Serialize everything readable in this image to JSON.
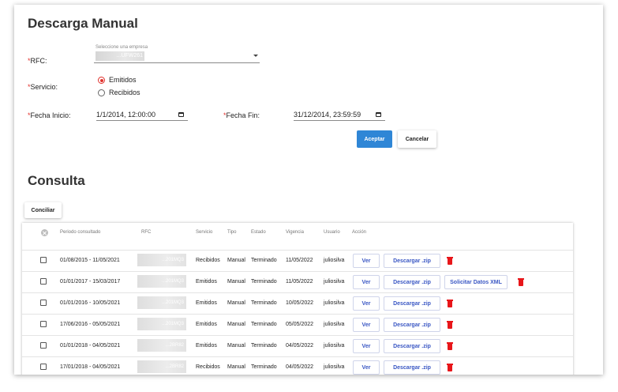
{
  "download": {
    "title": "Descarga Manual",
    "rfc_label": "RFC:",
    "company_hint": "Seleccione una empresa",
    "company_value": "...UFW261",
    "service_label": "Servicio:",
    "service_options": [
      "Emitidos",
      "Recibidos"
    ],
    "service_selected": "Emitidos",
    "start_label": "Fecha Inicio:",
    "start_value": "1/1/2014, 12:00:00",
    "end_label": "Fecha Fin:",
    "end_value": "31/12/2014, 23:59:59",
    "accept_label": "Aceptar",
    "cancel_label": "Cancelar",
    "required_mark": "*"
  },
  "query": {
    "title": "Consulta",
    "reconcile_label": "Conciliar",
    "columns": [
      "Periodo consultado",
      "RFC",
      "Servicio",
      "Tipo",
      "Estado",
      "Vigencia",
      "Usuario",
      "Acción"
    ],
    "view_label": "Ver",
    "download_zip_label": "Descargar .zip",
    "request_xml_label": "Solicitar Datos XML",
    "rows": [
      {
        "period": "01/08/2015 - 11/05/2021",
        "rfc": "...201MQ3",
        "service": "Recibidos",
        "type": "Manual",
        "status": "Terminado",
        "validity": "11/05/2022",
        "user": "juliosilva"
      },
      {
        "period": "01/01/2017 - 15/03/2017",
        "rfc": "...201MQ3",
        "service": "Emitidos",
        "type": "Manual",
        "status": "Terminado",
        "validity": "11/05/2022",
        "user": "juliosilva"
      },
      {
        "period": "01/01/2016 - 10/05/2021",
        "rfc": "...201MQ3",
        "service": "Emitidos",
        "type": "Manual",
        "status": "Terminado",
        "validity": "10/05/2022",
        "user": "juliosilva"
      },
      {
        "period": "17/06/2016 - 05/05/2021",
        "rfc": "...201MQ3",
        "service": "Emitidos",
        "type": "Manual",
        "status": "Terminado",
        "validity": "05/05/2022",
        "user": "juliosilva"
      },
      {
        "period": "01/01/2018 - 04/05/2021",
        "rfc": "...2BR82",
        "service": "Emitidos",
        "type": "Manual",
        "status": "Terminado",
        "validity": "04/05/2022",
        "user": "juliosilva"
      },
      {
        "period": "17/01/2018 - 04/05/2021",
        "rfc": "...2BR82",
        "service": "Recibidos",
        "type": "Manual",
        "status": "Terminado",
        "validity": "04/05/2022",
        "user": "juliosilva"
      }
    ]
  },
  "colors": {
    "required": "#e0312c",
    "primary": "#2f86d6",
    "link": "#3a57c4",
    "delete": "#e8161a"
  }
}
